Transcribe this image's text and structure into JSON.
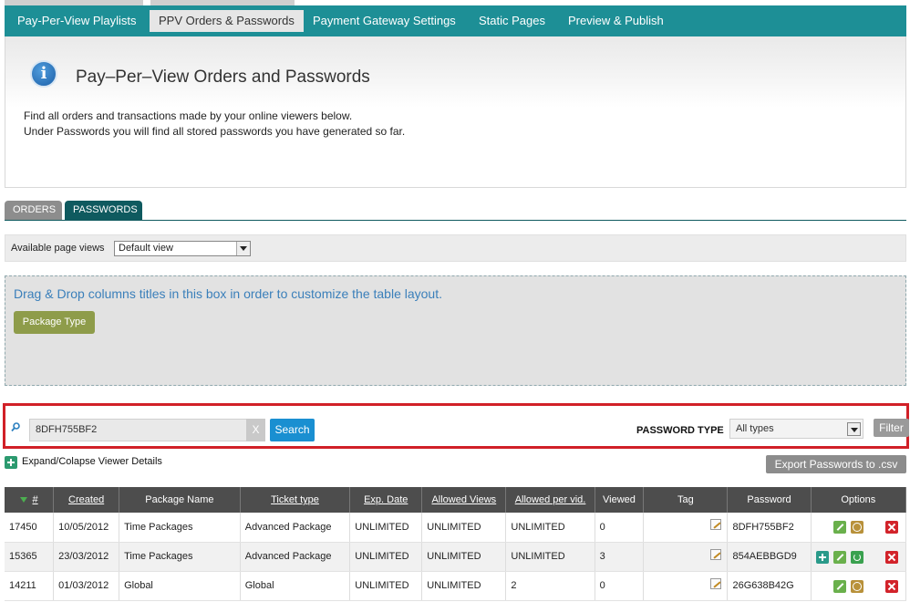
{
  "nav": {
    "items": [
      {
        "label": "Pay-Per-View Playlists"
      },
      {
        "label": "PPV Orders & Passwords",
        "active": true
      },
      {
        "label": "Payment Gateway Settings"
      },
      {
        "label": "Static Pages"
      },
      {
        "label": "Preview & Publish"
      }
    ]
  },
  "header": {
    "title": "Pay–Per–View Orders and Passwords",
    "desc1": "Find all orders and transactions made by your online viewers below.",
    "desc2": "Under Passwords you will find all stored passwords you have generated so far."
  },
  "tabs": {
    "orders": "ORDERS",
    "passwords": "PASSWORDS",
    "active": "PASSWORDS"
  },
  "views": {
    "label": "Available page views",
    "selected": "Default view"
  },
  "dragbox": {
    "text": "Drag & Drop columns titles in this box in order to customize the table layout.",
    "chip": "Package Type"
  },
  "search": {
    "value": "8DFH755BF2",
    "clear": "X",
    "button": "Search",
    "type_label": "PASSWORD TYPE",
    "type_selected": "All types",
    "filter": "Filter"
  },
  "expand_label": "Expand/Colapse Viewer Details",
  "export_label": "Export Passwords to .csv",
  "colors": {
    "nav": "#1d8f96",
    "accent_red": "#d12027",
    "search_blue": "#1a8fd1",
    "chip_olive": "#8e9c4a"
  },
  "table": {
    "headers": [
      "#",
      "Created",
      "Package Name",
      "Ticket type",
      "Exp. Date",
      "Allowed Views",
      "Allowed per vid.",
      "Viewed",
      "Tag",
      "Password",
      "Options"
    ],
    "rows": [
      {
        "id": "17450",
        "created": "10/05/2012",
        "package": "Time Packages",
        "ticket": "Advanced Package",
        "exp": "UNLIMITED",
        "allowed": "UNLIMITED",
        "per_vid": "UNLIMITED",
        "viewed": "0",
        "password": "8DFH755BF2"
      },
      {
        "id": "15365",
        "created": "23/03/2012",
        "package": "Time Packages",
        "ticket": "Advanced Package",
        "exp": "UNLIMITED",
        "allowed": "UNLIMITED",
        "per_vid": "UNLIMITED",
        "viewed": "3",
        "password": "854AEBBGD9"
      },
      {
        "id": "14211",
        "created": "01/03/2012",
        "package": "Global",
        "ticket": "Global",
        "exp": "UNLIMITED",
        "allowed": "UNLIMITED",
        "per_vid": "2",
        "viewed": "0",
        "password": "26G638B42G"
      }
    ]
  }
}
